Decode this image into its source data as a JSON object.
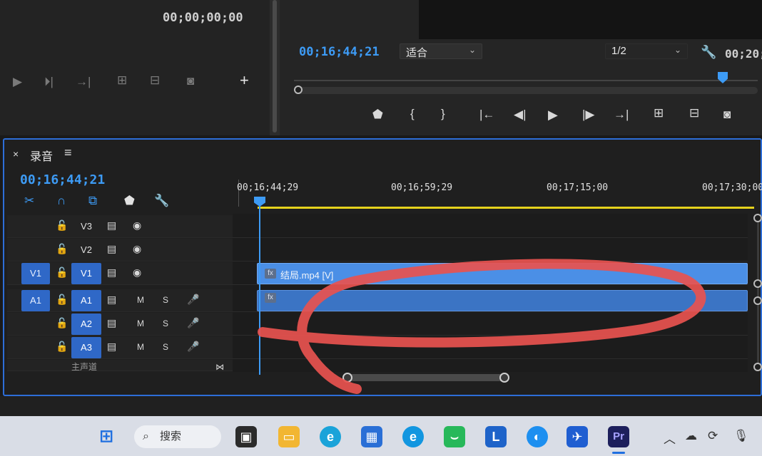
{
  "source_monitor": {
    "timecode": "00;00;00;00",
    "controls": [
      "play-icon",
      "step-forward-icon",
      "go-to-out-icon",
      "insert-icon",
      "overwrite-icon",
      "camera-icon",
      "plus-icon"
    ]
  },
  "program_monitor": {
    "timecode": "00;16;44;21",
    "fit_option": "适合",
    "resolution": "1/2",
    "duration_partial": "00;20;",
    "controls": [
      "add-marker-icon",
      "mark-in-icon",
      "mark-out-icon",
      "go-to-in-icon",
      "step-back-icon",
      "play-icon",
      "step-forward-icon",
      "go-to-out-icon",
      "lift-icon",
      "extract-icon",
      "camera-icon"
    ]
  },
  "timeline": {
    "sequence_name": "录音",
    "timecode": "00;16;44;21",
    "ruler_labels": [
      "00;16;44;29",
      "00;16;59;29",
      "00;17;15;00",
      "00;17;30;00"
    ],
    "tracks": [
      {
        "patch": "",
        "name": "V3",
        "type": "video"
      },
      {
        "patch": "",
        "name": "V2",
        "type": "video"
      },
      {
        "patch": "V1",
        "name": "V1",
        "type": "video"
      },
      {
        "patch": "A1",
        "name": "A1",
        "type": "audio"
      },
      {
        "patch": "",
        "name": "A2",
        "type": "audio"
      },
      {
        "patch": "",
        "name": "A3",
        "type": "audio"
      }
    ],
    "audio_toggles": {
      "mute": "M",
      "solo": "S"
    },
    "video_clip": {
      "fx": "fx",
      "name": "结局.mp4 [V]"
    },
    "audio_clip": {
      "fx": "fx"
    },
    "partial_track_label": "主声道"
  },
  "taskbar": {
    "search_label": "搜索",
    "premiere_label": "Pr",
    "accent": "#2f68c7"
  },
  "annotation_color": "#e8524f"
}
